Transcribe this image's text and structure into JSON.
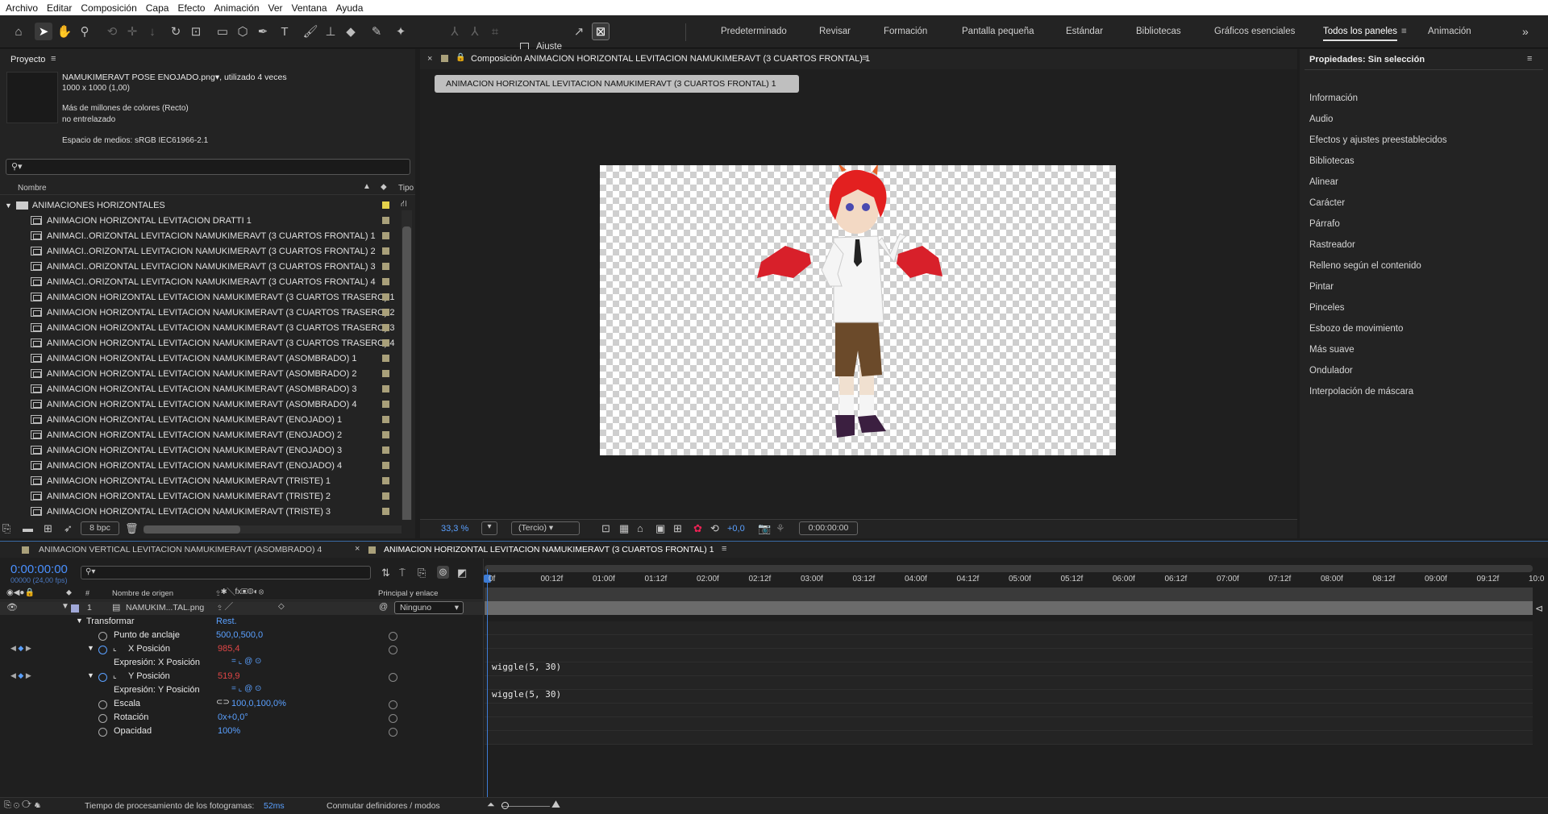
{
  "menu": [
    "Archivo",
    "Editar",
    "Composición",
    "Capa",
    "Efecto",
    "Animación",
    "Ver",
    "Ventana",
    "Ayuda"
  ],
  "toolbar": {
    "ajuste": "Ajuste",
    "workspaces": [
      "Predeterminado",
      "Revisar",
      "Formación",
      "Pantalla pequeña",
      "Estándar",
      "Bibliotecas",
      "Gráficos esenciales",
      "Todos los paneles",
      "Animación"
    ],
    "active_workspace": "Todos los paneles",
    "more": "»"
  },
  "project": {
    "title": "Proyecto",
    "file": "NAMUKIMERAVT POSE ENOJADO.png",
    "used": ", utilizado 4 veces",
    "dims": "1000 x 1000 (1,00)",
    "colors": "Más de millones de colores (Recto)",
    "interlace": "no entrelazado",
    "space": "Espacio de medios: sRGB IEC61966-2.1",
    "col_name": "Nombre",
    "col_type": "Tipo",
    "folder": "ANIMACIONES HORIZONTALES",
    "items": [
      "ANIMACION HORIZONTAL LEVITACION DRATTI 1",
      "ANIMACI..ORIZONTAL LEVITACION NAMUKIMERAVT (3 CUARTOS FRONTAL) 1",
      "ANIMACI..ORIZONTAL LEVITACION NAMUKIMERAVT (3 CUARTOS FRONTAL) 2",
      "ANIMACI..ORIZONTAL LEVITACION NAMUKIMERAVT (3 CUARTOS FRONTAL) 3",
      "ANIMACI..ORIZONTAL LEVITACION NAMUKIMERAVT (3 CUARTOS FRONTAL) 4",
      "ANIMACION HORIZONTAL LEVITACION NAMUKIMERAVT (3 CUARTOS TRASERO) 1",
      "ANIMACION HORIZONTAL LEVITACION NAMUKIMERAVT (3 CUARTOS TRASERO) 2",
      "ANIMACION HORIZONTAL LEVITACION NAMUKIMERAVT (3 CUARTOS TRASERO) 3",
      "ANIMACION HORIZONTAL LEVITACION NAMUKIMERAVT (3 CUARTOS TRASERO) 4",
      "ANIMACION HORIZONTAL LEVITACION NAMUKIMERAVT (ASOMBRADO) 1",
      "ANIMACION HORIZONTAL LEVITACION NAMUKIMERAVT (ASOMBRADO) 2",
      "ANIMACION HORIZONTAL LEVITACION NAMUKIMERAVT (ASOMBRADO) 3",
      "ANIMACION HORIZONTAL LEVITACION NAMUKIMERAVT (ASOMBRADO) 4",
      "ANIMACION HORIZONTAL LEVITACION NAMUKIMERAVT (ENOJADO) 1",
      "ANIMACION HORIZONTAL LEVITACION NAMUKIMERAVT (ENOJADO) 2",
      "ANIMACION HORIZONTAL LEVITACION NAMUKIMERAVT (ENOJADO) 3",
      "ANIMACION HORIZONTAL LEVITACION NAMUKIMERAVT (ENOJADO) 4",
      "ANIMACION HORIZONTAL LEVITACION NAMUKIMERAVT (TRISTE) 1",
      "ANIMACION HORIZONTAL LEVITACION NAMUKIMERAVT (TRISTE) 2",
      "ANIMACION HORIZONTAL LEVITACION NAMUKIMERAVT (TRISTE) 3"
    ],
    "bpc": "8 bpc"
  },
  "comp": {
    "tab": "Composición ANIMACION HORIZONTAL LEVITACION NAMUKIMERAVT (3 CUARTOS FRONTAL) 1",
    "button": "ANIMACION HORIZONTAL LEVITACION NAMUKIMERAVT (3 CUARTOS FRONTAL) 1",
    "zoom": "33,3 %",
    "res": "(Tercio)",
    "exposure": "+0,0",
    "time": "0:00:00:00"
  },
  "props": {
    "title": "Propiedades: Sin selección",
    "items": [
      "Información",
      "Audio",
      "Efectos y ajustes preestablecidos",
      "Bibliotecas",
      "Alinear",
      "Carácter",
      "Párrafo",
      "Rastreador",
      "Relleno según el contenido",
      "Pintar",
      "Pinceles",
      "Esbozo de movimiento",
      "Más suave",
      "Ondulador",
      "Interpolación de máscara"
    ]
  },
  "timeline": {
    "tab1": "ANIMACION VERTICAL LEVITACION NAMUKIMERAVT (ASOMBRADO) 4",
    "tab2": "ANIMACION HORIZONTAL LEVITACION NAMUKIMERAVT (3 CUARTOS FRONTAL) 1",
    "time": "0:00:00:00",
    "frames": "00000 (24,00 fps)",
    "col_source": "Nombre de origen",
    "col_parent": "Principal y enlace",
    "layer_num": "1",
    "layer_name": "NAMUKIM...TAL.png",
    "parent": "Ninguno",
    "transform": "Transformar",
    "reset": "Rest.",
    "anchor_l": "Punto de anclaje",
    "anchor_v": "500,0,500,0",
    "xpos_l": "X Posición",
    "xpos_v": "985,4",
    "xexpr_l": "Expresión: X Posición",
    "ypos_l": "Y Posición",
    "ypos_v": "519,9",
    "yexpr_l": "Expresión: Y Posición",
    "scale_l": "Escala",
    "scale_v": "100,0,100,0%",
    "rot_l": "Rotación",
    "rot_v": "0x+0,0°",
    "opac_l": "Opacidad",
    "opac_v": "100%",
    "expr1": "wiggle(5, 30)",
    "expr2": "wiggle(5, 30)",
    "ticks": [
      "0f",
      "00:12f",
      "01:00f",
      "01:12f",
      "02:00f",
      "02:12f",
      "03:00f",
      "03:12f",
      "04:00f",
      "04:12f",
      "05:00f",
      "05:12f",
      "06:00f",
      "06:12f",
      "07:00f",
      "07:12f",
      "08:00f",
      "08:12f",
      "09:00f",
      "09:12f",
      "10:0"
    ],
    "footer_time_l": "Tiempo de procesamiento de los fotogramas:",
    "footer_time_v": "52ms",
    "footer_toggle": "Conmutar definidores / modos"
  }
}
